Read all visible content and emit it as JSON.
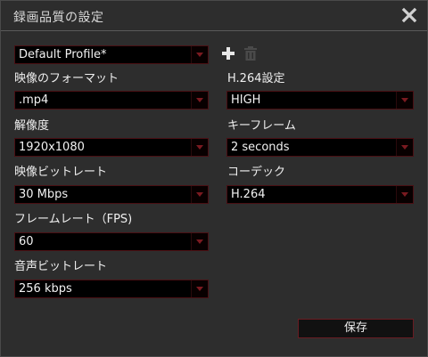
{
  "window": {
    "title": "録画品質の設定"
  },
  "profile": {
    "selected": "Default Profile*"
  },
  "left": {
    "video_format_label": "映像のフォーマット",
    "video_format_value": ".mp4",
    "resolution_label": "解像度",
    "resolution_value": "1920x1080",
    "video_bitrate_label": "映像ビットレート",
    "video_bitrate_value": "30 Mbps",
    "frame_rate_label": "フレームレート（FPS)",
    "frame_rate_value": "60",
    "audio_bitrate_label": "音声ビットレート",
    "audio_bitrate_value": "256 kbps"
  },
  "right": {
    "h264_label": "H.264設定",
    "h264_value": "HIGH",
    "keyframe_label": "キーフレーム",
    "keyframe_value": "2 seconds",
    "codec_label": "コーデック",
    "codec_value": "H.264"
  },
  "actions": {
    "save_label": "保存"
  },
  "icons": {
    "close": "close-icon",
    "add": "plus-icon",
    "delete": "trash-icon",
    "dropdown": "chevron-down-icon"
  },
  "colors": {
    "background": "#2d2d2d",
    "field_background": "#000000",
    "field_border": "#4a0f13",
    "arrow": "#7a1a20",
    "text": "#efefef"
  }
}
